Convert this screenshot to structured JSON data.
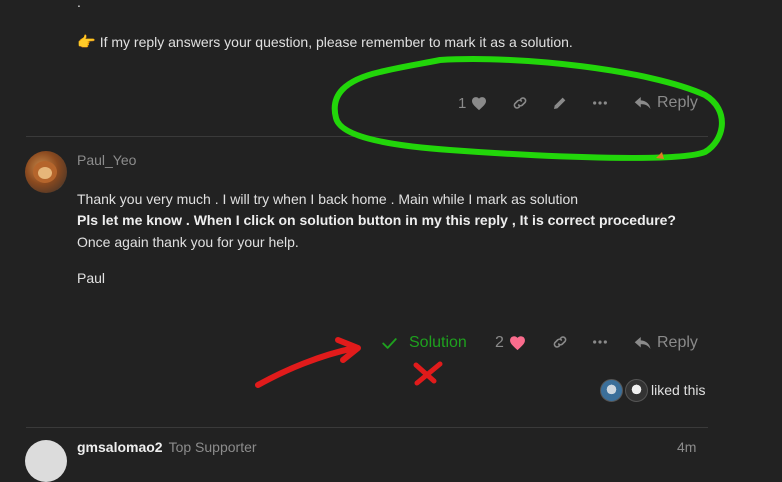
{
  "post1": {
    "dot": ".",
    "pointer_emoji": "👉",
    "solution_reminder": "If my reply answers your question, please remember to mark it as a solution.",
    "like_count": "1",
    "reply_label": "Reply"
  },
  "post2": {
    "author": "Paul_Yeo",
    "line1": "Thank you very much . I will try when I back home . Main while I mark as solution",
    "line2": "Pls let me know . When I click on solution button in my this reply , It is correct procedure?",
    "line3": "Once again thank you for your help.",
    "signature": "Paul",
    "solution_label": "Solution",
    "like_count": "2",
    "reply_label": "Reply",
    "liked_this": "liked this"
  },
  "post3": {
    "author": "gmsalomao2",
    "role": "Top Supporter",
    "time": "4m"
  },
  "colors": {
    "background": "#222222",
    "annotation_green": "#22d60a",
    "annotation_red": "#e11b1b",
    "solution_green": "#1ea11e",
    "heart_pink": "#fa6c8d"
  }
}
